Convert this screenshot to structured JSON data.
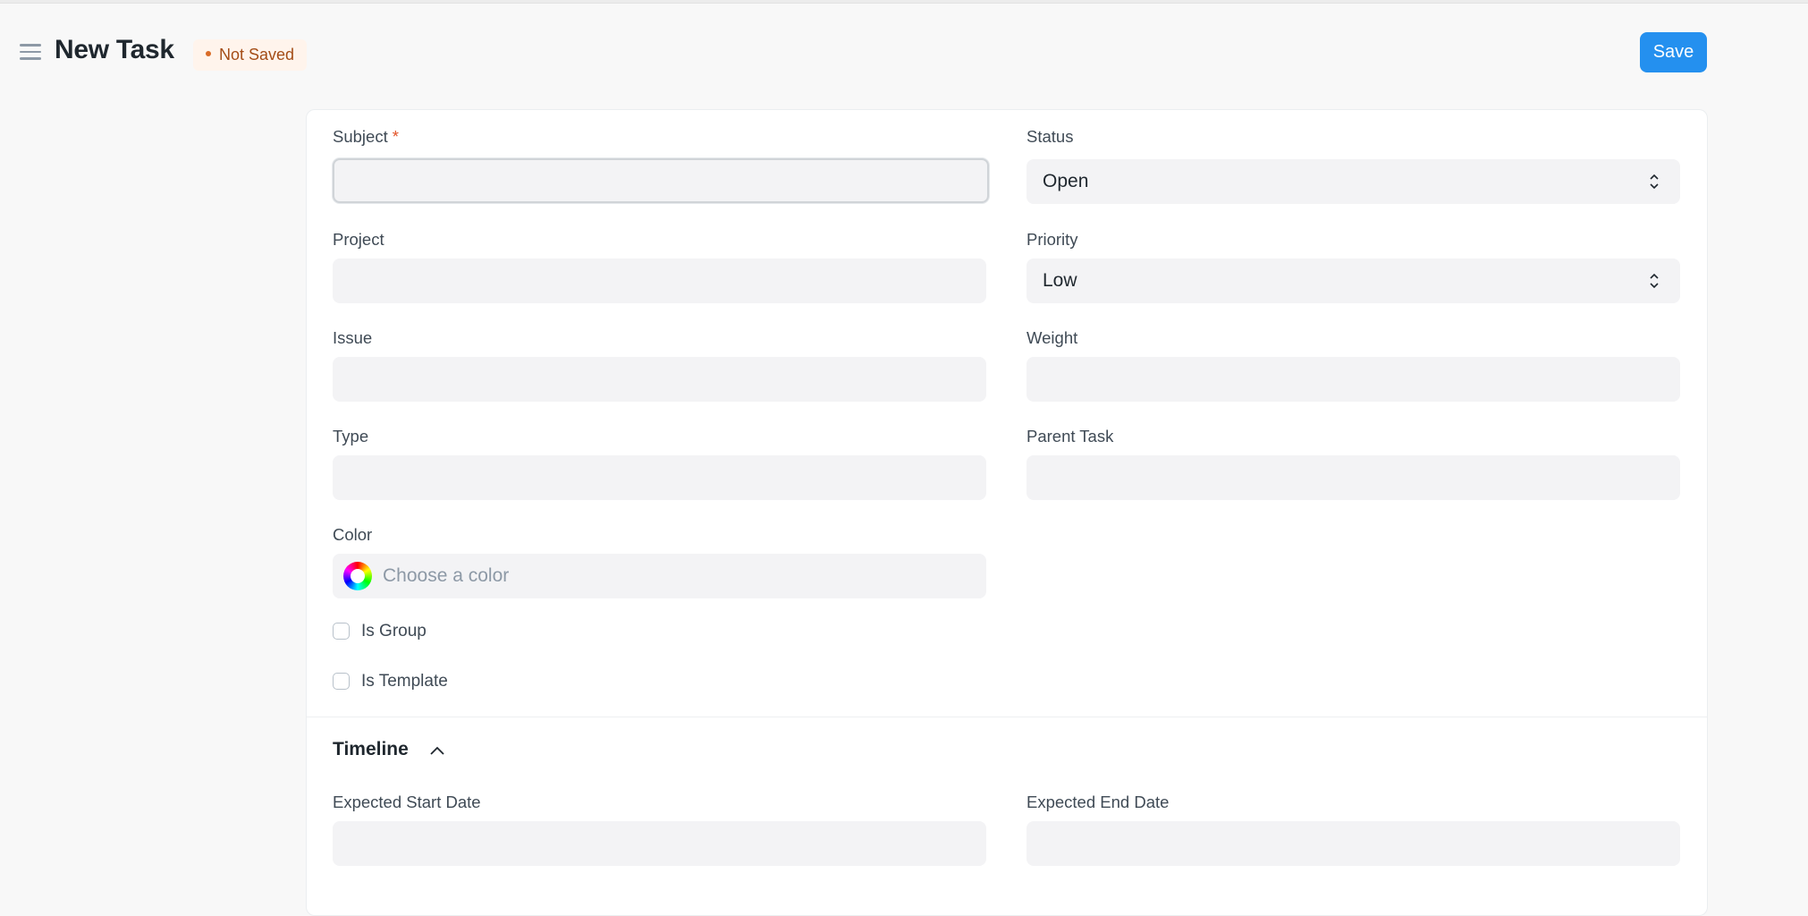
{
  "header": {
    "title": "New Task",
    "status": "Not Saved",
    "save_label": "Save"
  },
  "form": {
    "subject": {
      "label": "Subject",
      "required_mark": "*",
      "value": ""
    },
    "status": {
      "label": "Status",
      "value": "Open"
    },
    "project": {
      "label": "Project",
      "value": ""
    },
    "priority": {
      "label": "Priority",
      "value": "Low"
    },
    "issue": {
      "label": "Issue",
      "value": ""
    },
    "weight": {
      "label": "Weight",
      "value": ""
    },
    "type": {
      "label": "Type",
      "value": ""
    },
    "parent_task": {
      "label": "Parent Task",
      "value": ""
    },
    "color": {
      "label": "Color",
      "placeholder": "Choose a color"
    },
    "is_group": {
      "label": "Is Group",
      "checked": false
    },
    "is_template": {
      "label": "Is Template",
      "checked": false
    }
  },
  "timeline": {
    "title": "Timeline",
    "expected_start_date": {
      "label": "Expected Start Date",
      "value": ""
    },
    "expected_end_date": {
      "label": "Expected End Date",
      "value": ""
    }
  },
  "icons": {
    "menu": "hamburger-menu-icon",
    "select": "select-arrows-icon",
    "color": "color-wheel-icon",
    "collapse": "chevron-up-icon"
  },
  "colors": {
    "accent": "#2490ef",
    "status_badge_bg": "#fff4ec",
    "status_badge_text": "#a44d17",
    "required": "#e2552a"
  }
}
